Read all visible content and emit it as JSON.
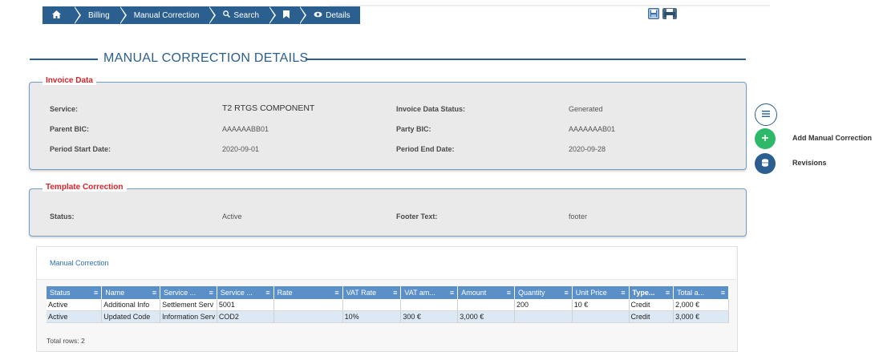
{
  "breadcrumb": [
    {
      "icon": "home-icon",
      "glyph": "🏠",
      "label": ""
    },
    {
      "icon": "",
      "glyph": "",
      "label": "Billing"
    },
    {
      "icon": "",
      "glyph": "",
      "label": "Manual Correction"
    },
    {
      "icon": "search-icon",
      "glyph": "🔍",
      "label": "Search"
    },
    {
      "icon": "bookmark-icon",
      "glyph": "▮",
      "label": ""
    },
    {
      "icon": "eye-icon",
      "glyph": "👁",
      "label": "Details"
    }
  ],
  "page_title": "MANUAL CORRECTION DETAILS",
  "invoice_data": {
    "legend": "Invoice Data",
    "service_label": "Service:",
    "service_value": "T2 RTGS COMPONENT",
    "status_label": "Invoice Data Status:",
    "status_value": "Generated",
    "parent_bic_label": "Parent BIC:",
    "parent_bic_value": "AAAAAABB01",
    "party_bic_label": "Party BIC:",
    "party_bic_value": "AAAAAAAB01",
    "start_label": "Period Start Date:",
    "start_value": "2020-09-01",
    "end_label": "Period End Date:",
    "end_value": "2020-09-28"
  },
  "template_correction": {
    "legend": "Template Correction",
    "status_label": "Status:",
    "status_value": "Active",
    "footer_label": "Footer Text:",
    "footer_value": "footer"
  },
  "actions": {
    "add_label": "Add Manual Correction",
    "revisions_label": "Revisions"
  },
  "list": {
    "tab_label": "Manual Correction",
    "columns": [
      "Status",
      "Name",
      "Service ...",
      "Service ...",
      "Rate",
      "VAT Rate",
      "VAT am...",
      "Amount",
      "Quantity",
      "Unit Price",
      "Type...",
      "Total a..."
    ],
    "rows": [
      [
        "Active",
        "Additional Info",
        "Settlement Serv",
        "5001",
        "",
        "",
        "",
        "",
        "200",
        "10 €",
        "Credit",
        "2,000 €"
      ],
      [
        "Active",
        "Updated Code",
        "Information Serv",
        "COD2",
        "",
        "10%",
        "300 €",
        "3,000 €",
        "",
        "",
        "Credit",
        "3,000 €"
      ]
    ],
    "total_rows": "Total rows: 2"
  }
}
